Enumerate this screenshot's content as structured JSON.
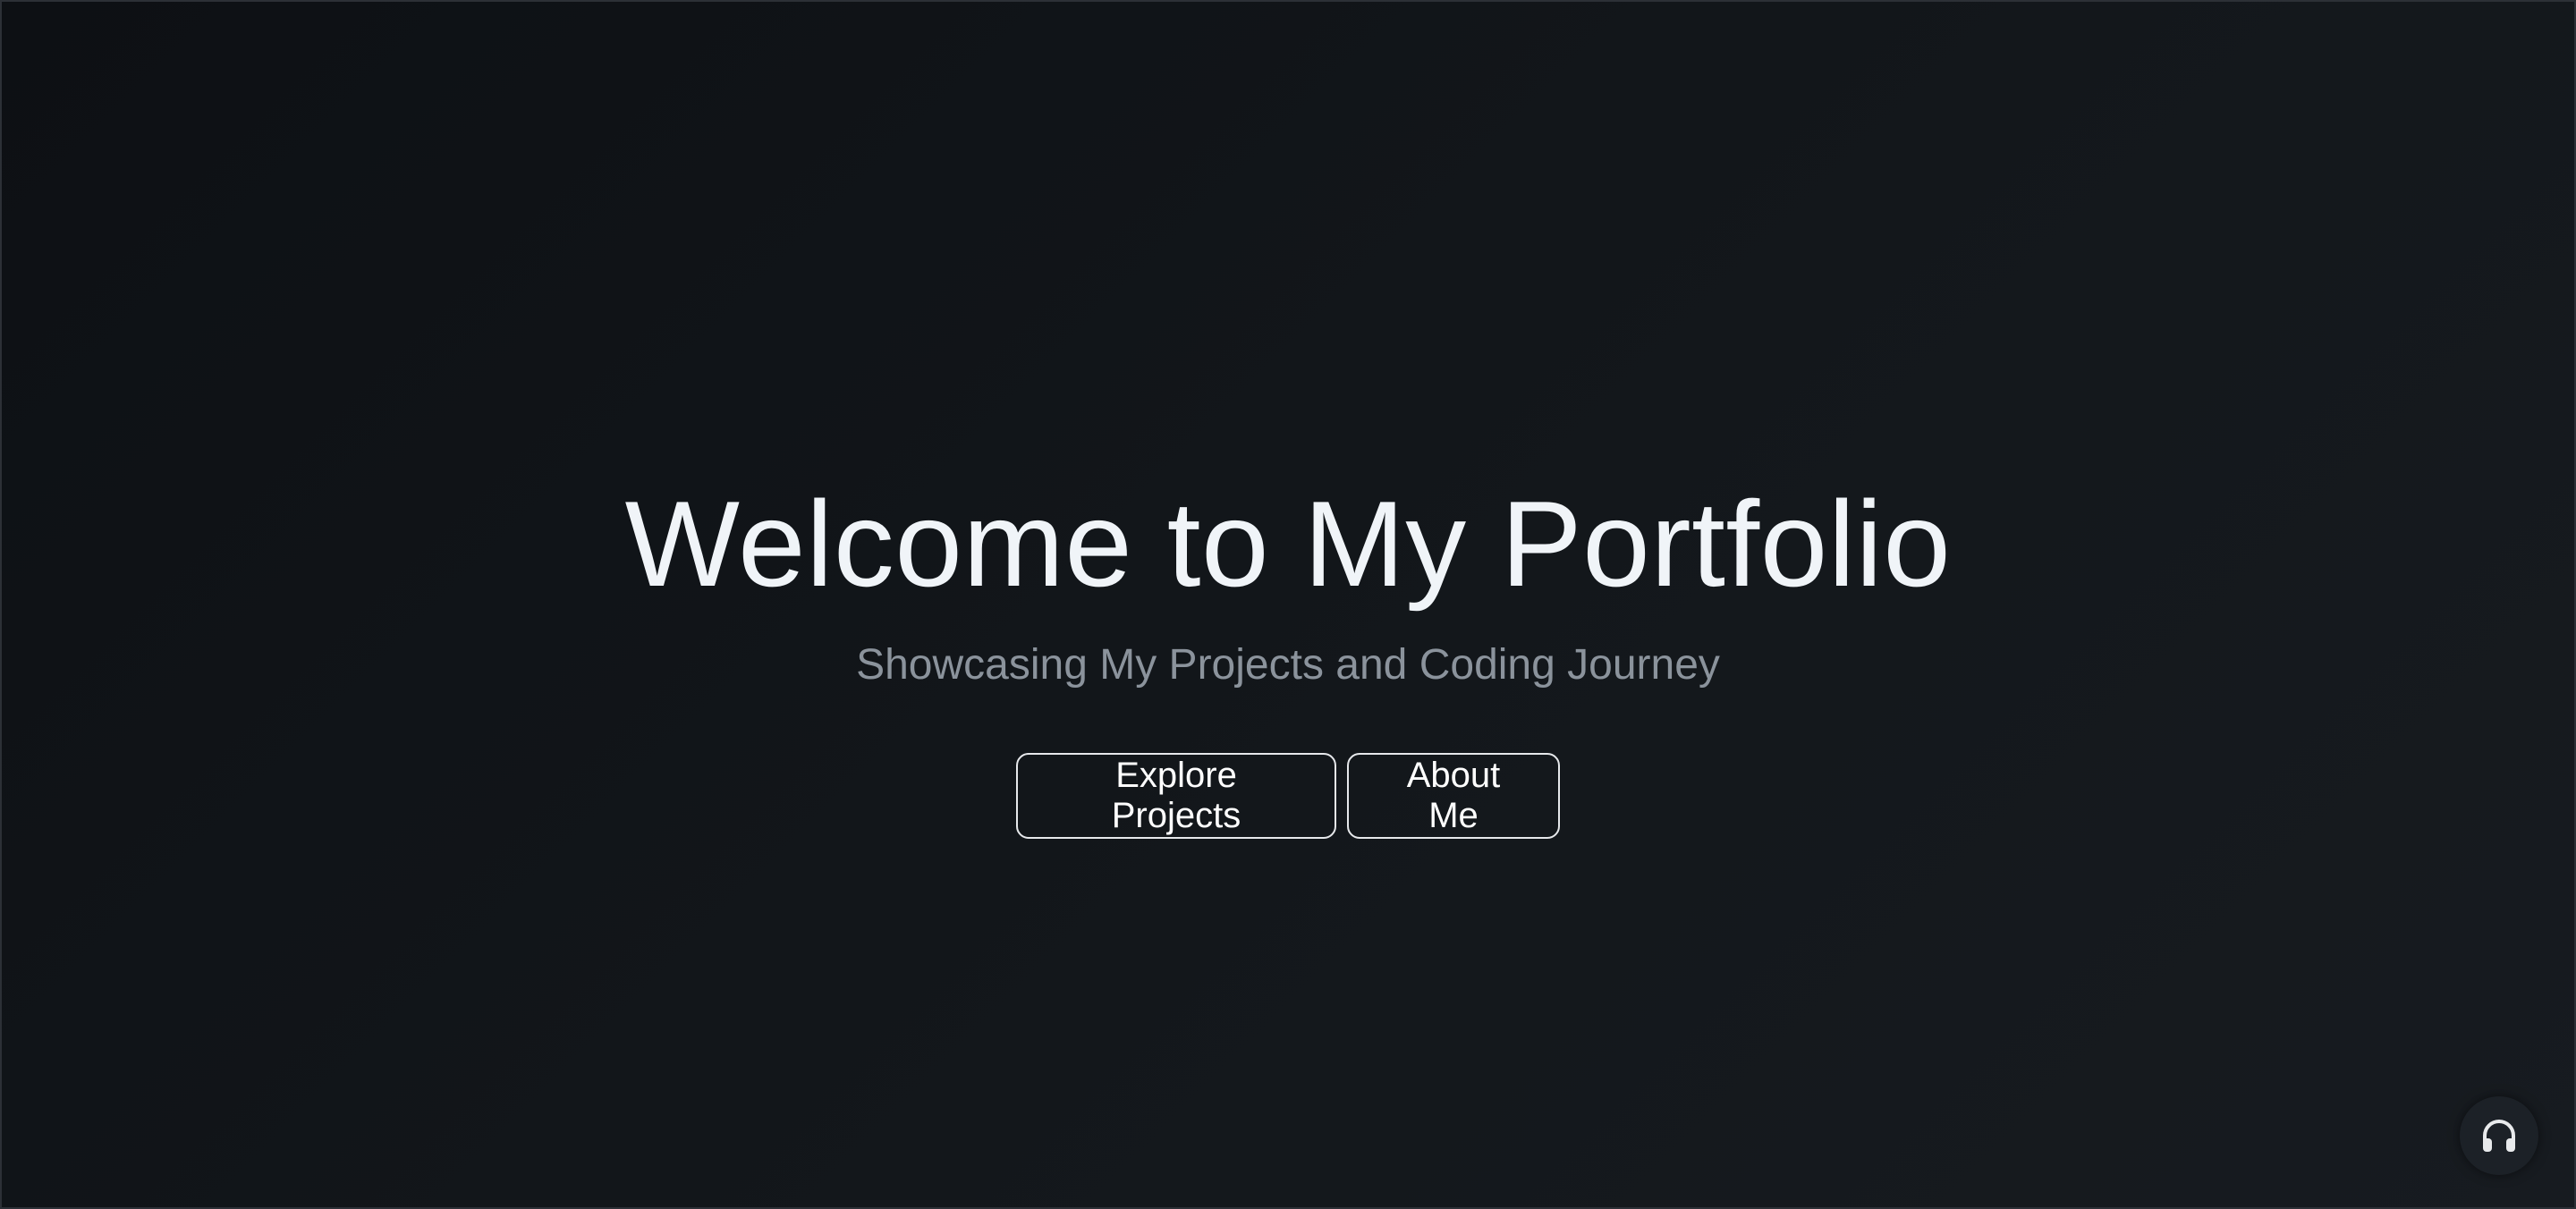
{
  "hero": {
    "title": "Welcome to My Portfolio",
    "subtitle": "Showcasing My Projects and Coding Journey"
  },
  "buttons": {
    "explore_label": "Explore Projects",
    "about_label": "About Me"
  },
  "audio_button": {
    "icon": "headphones-icon"
  },
  "colors": {
    "background": "#0f1216",
    "title": "#f0f4f8",
    "subtitle": "#8b939c",
    "button_border": "#e6e8eb"
  }
}
